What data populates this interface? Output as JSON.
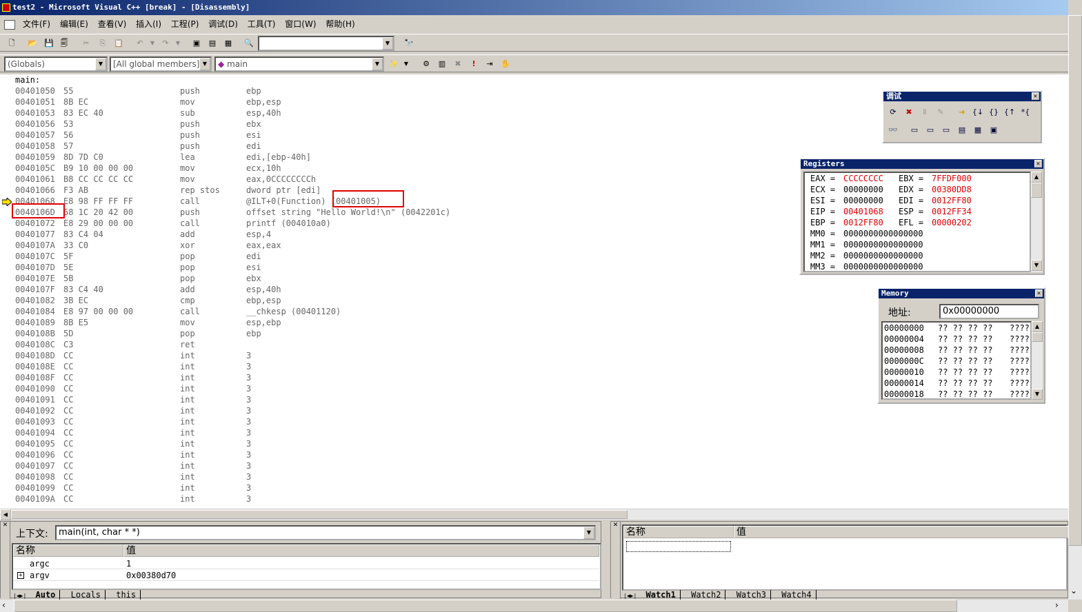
{
  "window": {
    "title": "test2 - Microsoft Visual C++ [break] - [Disassembly]"
  },
  "menu": {
    "items": [
      "文件(F)",
      "编辑(E)",
      "查看(V)",
      "插入(I)",
      "工程(P)",
      "调试(D)",
      "工具(T)",
      "窗口(W)",
      "帮助(H)"
    ]
  },
  "toolbar": {
    "find_combo_value": "",
    "globals_combo": "(Globals)",
    "members_combo": "[All global members]",
    "function_combo": "main"
  },
  "disasm": {
    "label": "main:",
    "lines": [
      {
        "addr": "00401050",
        "bytes": "55",
        "op": "push",
        "arg": "ebp"
      },
      {
        "addr": "00401051",
        "bytes": "8B EC",
        "op": "mov",
        "arg": "ebp,esp"
      },
      {
        "addr": "00401053",
        "bytes": "83 EC 40",
        "op": "sub",
        "arg": "esp,40h"
      },
      {
        "addr": "00401056",
        "bytes": "53",
        "op": "push",
        "arg": "ebx"
      },
      {
        "addr": "00401057",
        "bytes": "56",
        "op": "push",
        "arg": "esi"
      },
      {
        "addr": "00401058",
        "bytes": "57",
        "op": "push",
        "arg": "edi"
      },
      {
        "addr": "00401059",
        "bytes": "8D 7D C0",
        "op": "lea",
        "arg": "edi,[ebp-40h]"
      },
      {
        "addr": "0040105C",
        "bytes": "B9 10 00 00 00",
        "op": "mov",
        "arg": "ecx,10h"
      },
      {
        "addr": "00401061",
        "bytes": "B8 CC CC CC CC",
        "op": "mov",
        "arg": "eax,0CCCCCCCCh"
      },
      {
        "addr": "00401066",
        "bytes": "F3 AB",
        "op": "rep stos",
        "arg": "dword ptr [edi]"
      },
      {
        "addr": "00401068",
        "bytes": "E8 98 FF FF FF",
        "op": "call",
        "arg": "@ILT+0(Function) (00401005)"
      },
      {
        "addr": "0040106D",
        "bytes": "68 1C 20 42 00",
        "op": "push",
        "arg": "offset string \"Hello World!\\n\" (0042201c)"
      },
      {
        "addr": "00401072",
        "bytes": "E8 29 00 00 00",
        "op": "call",
        "arg": "printf (004010a0)"
      },
      {
        "addr": "00401077",
        "bytes": "83 C4 04",
        "op": "add",
        "arg": "esp,4"
      },
      {
        "addr": "0040107A",
        "bytes": "33 C0",
        "op": "xor",
        "arg": "eax,eax"
      },
      {
        "addr": "0040107C",
        "bytes": "5F",
        "op": "pop",
        "arg": "edi"
      },
      {
        "addr": "0040107D",
        "bytes": "5E",
        "op": "pop",
        "arg": "esi"
      },
      {
        "addr": "0040107E",
        "bytes": "5B",
        "op": "pop",
        "arg": "ebx"
      },
      {
        "addr": "0040107F",
        "bytes": "83 C4 40",
        "op": "add",
        "arg": "esp,40h"
      },
      {
        "addr": "00401082",
        "bytes": "3B EC",
        "op": "cmp",
        "arg": "ebp,esp"
      },
      {
        "addr": "00401084",
        "bytes": "E8 97 00 00 00",
        "op": "call",
        "arg": "__chkesp (00401120)"
      },
      {
        "addr": "00401089",
        "bytes": "8B E5",
        "op": "mov",
        "arg": "esp,ebp"
      },
      {
        "addr": "0040108B",
        "bytes": "5D",
        "op": "pop",
        "arg": "ebp"
      },
      {
        "addr": "0040108C",
        "bytes": "C3",
        "op": "ret",
        "arg": ""
      },
      {
        "addr": "0040108D",
        "bytes": "CC",
        "op": "int",
        "arg": "3"
      },
      {
        "addr": "0040108E",
        "bytes": "CC",
        "op": "int",
        "arg": "3"
      },
      {
        "addr": "0040108F",
        "bytes": "CC",
        "op": "int",
        "arg": "3"
      },
      {
        "addr": "00401090",
        "bytes": "CC",
        "op": "int",
        "arg": "3"
      },
      {
        "addr": "00401091",
        "bytes": "CC",
        "op": "int",
        "arg": "3"
      },
      {
        "addr": "00401092",
        "bytes": "CC",
        "op": "int",
        "arg": "3"
      },
      {
        "addr": "00401093",
        "bytes": "CC",
        "op": "int",
        "arg": "3"
      },
      {
        "addr": "00401094",
        "bytes": "CC",
        "op": "int",
        "arg": "3"
      },
      {
        "addr": "00401095",
        "bytes": "CC",
        "op": "int",
        "arg": "3"
      },
      {
        "addr": "00401096",
        "bytes": "CC",
        "op": "int",
        "arg": "3"
      },
      {
        "addr": "00401097",
        "bytes": "CC",
        "op": "int",
        "arg": "3"
      },
      {
        "addr": "00401098",
        "bytes": "CC",
        "op": "int",
        "arg": "3"
      },
      {
        "addr": "00401099",
        "bytes": "CC",
        "op": "int",
        "arg": "3"
      },
      {
        "addr": "0040109A",
        "bytes": "CC",
        "op": "int",
        "arg": "3"
      }
    ],
    "current_line_index": 10
  },
  "debug_toolbar": {
    "title": "调试"
  },
  "registers": {
    "title": "Registers",
    "rows": [
      [
        {
          "name": "EAX",
          "value": "CCCCCCCC",
          "changed": true
        },
        {
          "name": "EBX",
          "value": "7FFDF000",
          "changed": true
        }
      ],
      [
        {
          "name": "ECX",
          "value": "00000000",
          "changed": false
        },
        {
          "name": "EDX",
          "value": "00380DD8",
          "changed": true
        }
      ],
      [
        {
          "name": "ESI",
          "value": "00000000",
          "changed": false
        },
        {
          "name": "EDI",
          "value": "0012FF80",
          "changed": true
        }
      ],
      [
        {
          "name": "EIP",
          "value": "00401068",
          "changed": true
        },
        {
          "name": "ESP",
          "value": "0012FF34",
          "changed": true
        }
      ],
      [
        {
          "name": "EBP",
          "value": "0012FF80",
          "changed": true
        },
        {
          "name": "EFL",
          "value": "00000202",
          "changed": true
        }
      ],
      [
        {
          "name": "MM0",
          "value": "0000000000000000",
          "changed": false
        }
      ],
      [
        {
          "name": "MM1",
          "value": "0000000000000000",
          "changed": false
        }
      ],
      [
        {
          "name": "MM2",
          "value": "0000000000000000",
          "changed": false
        }
      ],
      [
        {
          "name": "MM3",
          "value": "0000000000000000",
          "changed": false
        }
      ]
    ]
  },
  "memory": {
    "title": "Memory",
    "address_label": "地址:",
    "address_value": "0x00000000",
    "rows": [
      {
        "addr": "00000000",
        "bytes": "?? ?? ?? ??",
        "ascii": "????"
      },
      {
        "addr": "00000004",
        "bytes": "?? ?? ?? ??",
        "ascii": "????"
      },
      {
        "addr": "00000008",
        "bytes": "?? ?? ?? ??",
        "ascii": "????"
      },
      {
        "addr": "0000000C",
        "bytes": "?? ?? ?? ??",
        "ascii": "????"
      },
      {
        "addr": "00000010",
        "bytes": "?? ?? ?? ??",
        "ascii": "????"
      },
      {
        "addr": "00000014",
        "bytes": "?? ?? ?? ??",
        "ascii": "????"
      },
      {
        "addr": "00000018",
        "bytes": "?? ?? ?? ??",
        "ascii": "????"
      }
    ]
  },
  "variables": {
    "context_label": "上下文:",
    "context_value": "main(int, char * *)",
    "col_name": "名称",
    "col_value": "值",
    "rows": [
      {
        "name": "argc",
        "value": "1",
        "expandable": false
      },
      {
        "name": "argv",
        "value": "0x00380d70",
        "expandable": true
      }
    ],
    "tabs": [
      "Auto",
      "Locals",
      "this"
    ]
  },
  "watch": {
    "col_name": "名称",
    "col_value": "值",
    "tabs": [
      "Watch1",
      "Watch2",
      "Watch3",
      "Watch4"
    ]
  },
  "colors": {
    "title_start": "#0a246a",
    "title_end": "#a6caf0",
    "changed_register": "#e00000",
    "highlight_box": "#e00000",
    "face": "#d4d0c8"
  }
}
